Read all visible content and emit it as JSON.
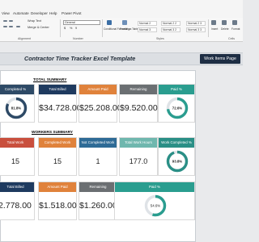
{
  "ribbon": {
    "tabs": [
      "View",
      "Automate",
      "Developer",
      "Help",
      "Power Pivot"
    ],
    "wrap_text": "Wrap Text",
    "merge_center": "Merge & Center",
    "number_format": "General",
    "currency_symbol": "$",
    "percent_symbol": "%",
    "thousands_symbol": "9",
    "group_alignment": "Alignment",
    "group_number": "Number",
    "group_styles": "Styles",
    "group_cells": "Cells",
    "conditional_formatting": "Conditional Formatting",
    "format_as_table": "Format as Table",
    "style_cells": [
      "Normal 2",
      "Normal 2 2",
      "Normal 2 3",
      "Normal 3",
      "Normal 3 2",
      "Normal 3 3"
    ],
    "insert": "Insert",
    "delete": "Delete",
    "format": "Format"
  },
  "sheet": {
    "title": "Contractor Time Tracker Excel Template",
    "work_items_button": "Work Items Page"
  },
  "total_summary": {
    "title": "TOTAL SUMMARY",
    "cards": [
      {
        "label": "Completed %",
        "value": "81.8%",
        "color": "#2e4a66",
        "gauge": 81.8
      },
      {
        "label": "Total Billed",
        "value": "$34.728.00",
        "color": "#1e3a5f"
      },
      {
        "label": "Amount Paid",
        "value": "$25.208.00",
        "color": "#e0823b"
      },
      {
        "label": "Remaining",
        "value": "$9.520.00",
        "color": "#6b6f72"
      },
      {
        "label": "Paid %",
        "value": "72.6%",
        "color": "#2a9d8f",
        "gauge": 72.6
      }
    ]
  },
  "workers_summary": {
    "title": "WORKERS SUMMARY",
    "cards": [
      {
        "label": "Total Work",
        "value": "15",
        "color": "#c94f3d"
      },
      {
        "label": "Completed Work",
        "value": "15",
        "color": "#e0823b"
      },
      {
        "label": "Not Completed Work",
        "value": "1",
        "color": "#2e6b96"
      },
      {
        "label": "Total Work Hours",
        "value": "177.0",
        "color": "#6fb7ae"
      },
      {
        "label": "Work Completed %",
        "value": "93.8%",
        "color": "#2a8f86",
        "gauge": 93.8
      }
    ],
    "cards2": [
      {
        "label": "Total Billed",
        "value": "2.778.00",
        "color": "#1e3a5f"
      },
      {
        "label": "Amount Paid",
        "value": "$1.518.00",
        "color": "#e0823b"
      },
      {
        "label": "Remaining",
        "value": "$1.260.00",
        "color": "#6b6f72"
      },
      {
        "label": "Paid %",
        "value": "54.6%",
        "color": "#2a9d8f",
        "gauge": 54.6
      }
    ]
  }
}
